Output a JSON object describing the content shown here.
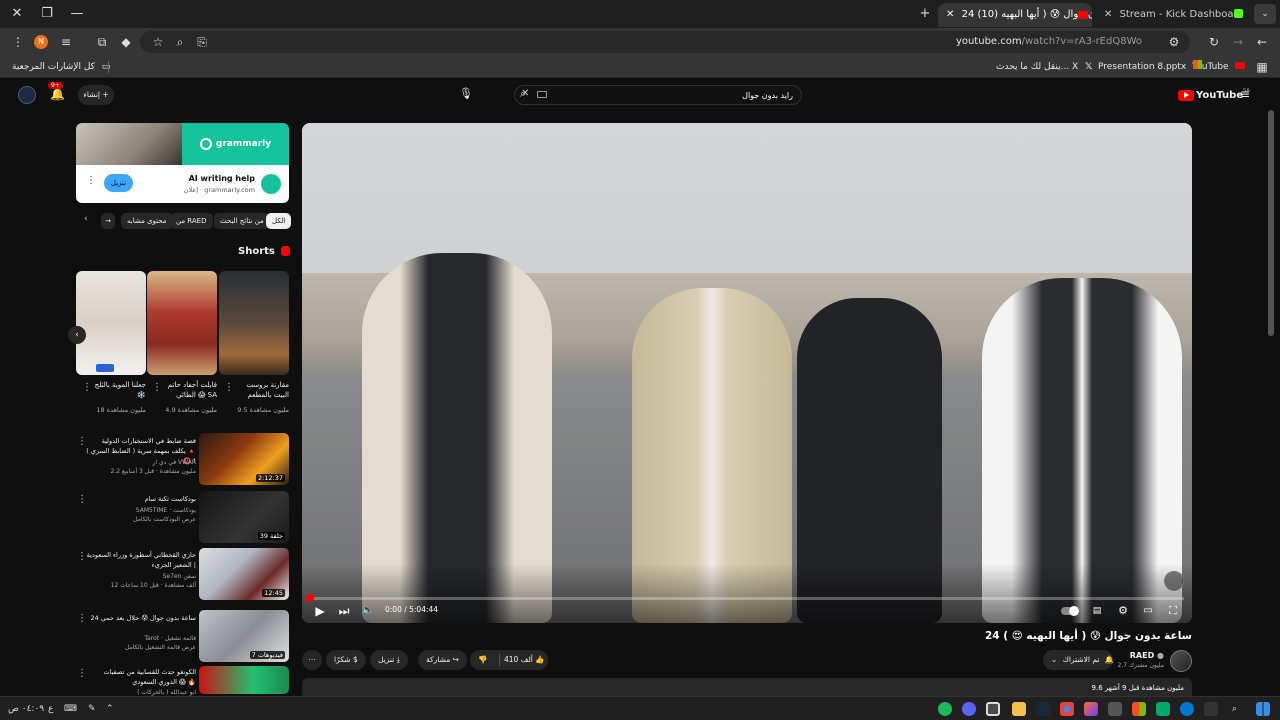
{
  "browser": {
    "tabs": [
      {
        "label": "24 ساعة بدون جوال 😰 ( أيها البهيه (10)",
        "active": true
      },
      {
        "label": "Stream - Kick Dashboard",
        "active": false
      }
    ],
    "url_host": "youtube.com",
    "url_path": "/watch?v=rA3-rEdQ8Wo",
    "profile_initial": "N",
    "bookmarks": {
      "all_bookmarks": "كل الإشارات المرجعية",
      "items": [
        "YouTube",
        "Presentation 8.pptx",
        "ينقل لك ما يحدث... X"
      ]
    }
  },
  "youtube": {
    "logo_text": "YouTube",
    "logo_region": "SA",
    "search_value": "رايد بدون جوال",
    "create_label": "إنشاء",
    "notif_count": "9+"
  },
  "ad": {
    "brand": "grammarly",
    "title": "AI writing help",
    "sponsor": "إعلان · grammarly.com",
    "cta": "تنزيل"
  },
  "chips": [
    "الكل",
    "من نتائج البحث",
    "من RAED",
    "محتوى مشابه"
  ],
  "shorts": {
    "title": "Shorts",
    "items": [
      {
        "title": "مقارنة بروست البيت بالمطعم",
        "views": "9.5 مليون مشاهدة"
      },
      {
        "title": "قابلت أحفاد حاتم الطائي 😱 SA",
        "views": "4.9 مليون مشاهدة"
      },
      {
        "title": "جعلنا الموية بالثلج ❄️",
        "views": "18 مليون مشاهدة"
      }
    ]
  },
  "recommendations": [
    {
      "title": "قصة ضابط في الاستخبارات الدولية يكلف بمهمة سرية ( الضابط السري ) 🔺 ⭕ !",
      "channel": "في دي ار VWAR",
      "meta": "2.2 مليون مشاهدة · قبل 3 أسابيع",
      "duration": "2:12:37"
    },
    {
      "title": "بودكاست ثكنة سام",
      "channel": "SAM5TIME · بودكاست",
      "meta": "عرض البودكاست بالكامل",
      "duration": "39 حلقة"
    },
    {
      "title": "حازي القحطاني أسطورة وزراء السعودية | الشعير الجريء",
      "channel": "Se7en سفن",
      "meta": "12 ألف مشاهدة · قبل 10 ساعات",
      "duration": "12:45"
    },
    {
      "title": "24 ساعة بدون جوال 😰 حلال بعد حمي",
      "channel": "Tarot · قائمة تشغيل",
      "meta": "عرض قائمة التشغيل بالكامل",
      "duration": "7 فيديوهات"
    },
    {
      "title": "الكونغو حدث للقسابية من تصفيات الدوري السعودي 😱 🔥",
      "channel": "ابو عبدالله ( بالحركات )",
      "meta": "",
      "duration": ""
    }
  ],
  "player": {
    "time": "0:00 / 5:04:44"
  },
  "video": {
    "title": "24 ساعة بدون جوال 😰 ( أيها البهيه 😍 )",
    "channel": "RAED",
    "subscribers": "2.7 مليون مشترك",
    "subscribed_label": "تم الاشتراك",
    "likes": "410 ألف",
    "share": "مشاركة",
    "download": "تنزيل",
    "thanks": "شكرًا",
    "description_stats": "9.6 مليون مشاهدة  قبل 9 أشهر"
  },
  "taskbar": {
    "clock": "٠٤:٠٩ ص",
    "lang": "ع"
  },
  "colors": {
    "yt_red": "#ff0000",
    "grammarly_green": "#15c39a",
    "ad_button": "#3ea6ff"
  }
}
